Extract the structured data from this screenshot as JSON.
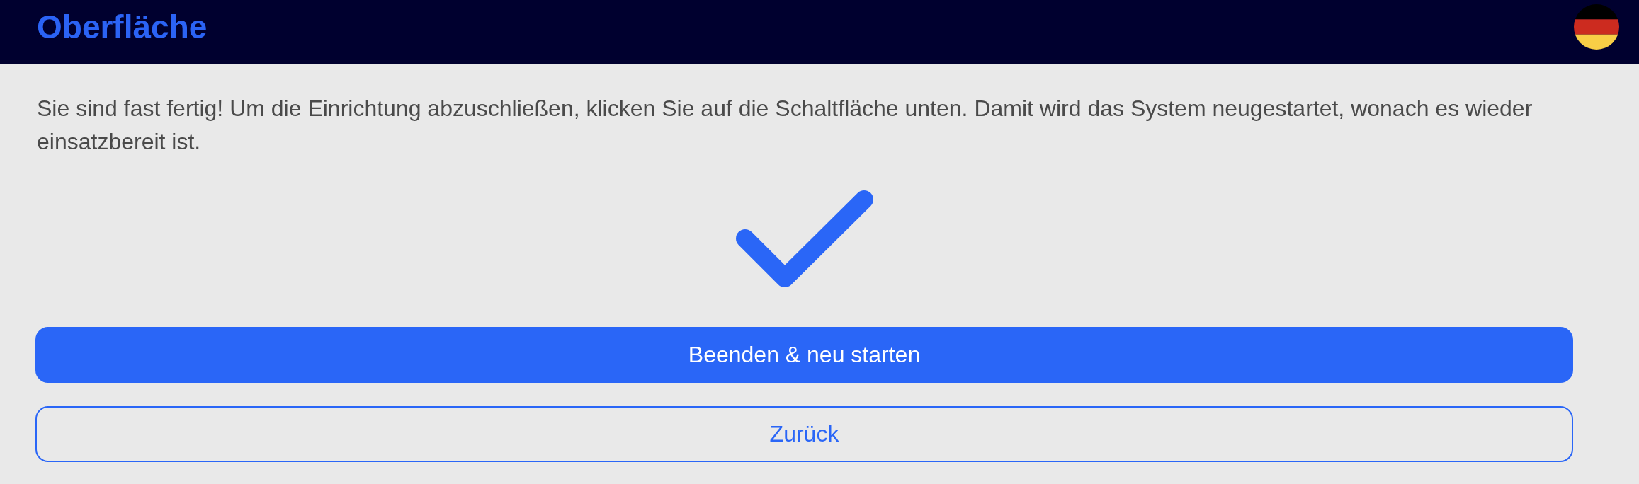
{
  "header": {
    "title": "Oberfläche"
  },
  "message": "Sie sind fast fertig! Um die Einrichtung abzuschließen, klicken Sie auf die Schaltfläche unten. Damit wird das System neugestartet, wonach es wieder einsatzbereit ist.",
  "buttons": [
    {
      "label": "Beenden & neu starten",
      "kind": "primary"
    },
    {
      "label": "Zurück",
      "kind": "secondary"
    }
  ]
}
